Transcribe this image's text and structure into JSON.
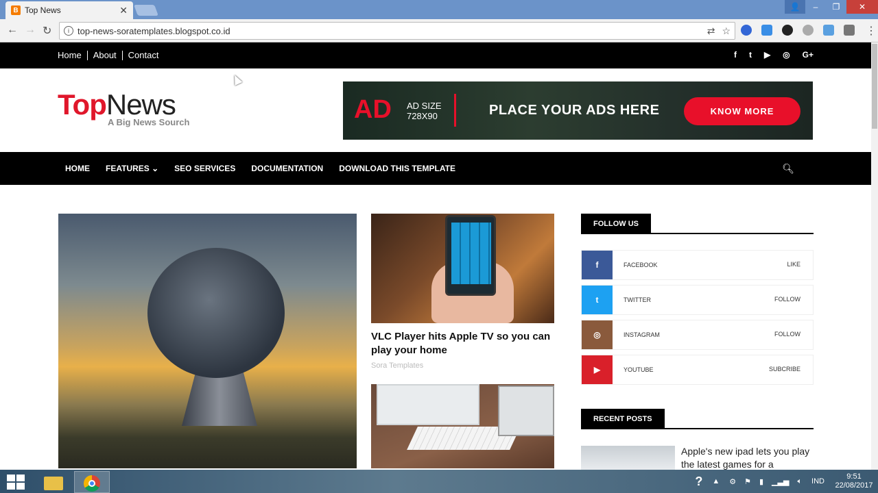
{
  "browser": {
    "tab_title": "Top News",
    "tab_close": "✕",
    "url": "top-news-soratemplates.blogspot.co.id"
  },
  "site": {
    "top_links": [
      "Home",
      "About",
      "Contact"
    ],
    "top_social": [
      "f",
      "t",
      "▶",
      "◎",
      "G+"
    ],
    "logo_top": "Top",
    "logo_news": "News",
    "tagline": "A Big News Sourch",
    "ad": {
      "big": "AD",
      "size_line1": "AD SIZE",
      "size_line2": "728X90",
      "place": "PLACE YOUR ADS HERE",
      "button": "KNOW MORE"
    },
    "nav": [
      "HOME",
      "FEATURES",
      "SEO SERVICES",
      "DOCUMENTATION",
      "DOWNLOAD THIS TEMPLATE"
    ],
    "post1": {
      "title": "VLC Player hits Apple TV so you can play your home",
      "author": "Sora Templates"
    },
    "follow_us": {
      "heading": "FOLLOW US",
      "rows": [
        {
          "icon": "f",
          "name": "FACEBOOK",
          "action": "LIKE",
          "color": "#3b5998"
        },
        {
          "icon": "t",
          "name": "TWITTER",
          "action": "FOLLOW",
          "color": "#1da1f2"
        },
        {
          "icon": "◎",
          "name": "INSTAGRAM",
          "action": "FOLLOW",
          "color": "#8a5a3c"
        },
        {
          "icon": "▶",
          "name": "YOUTUBE",
          "action": "SUBCRIBE",
          "color": "#d9202a"
        }
      ]
    },
    "recent_posts": {
      "heading": "RECENT POSTS",
      "first_title": "Apple's new ipad lets you play the latest games for a"
    }
  },
  "taskbar": {
    "lang": "IND",
    "time": "9:51",
    "date": "22/08/2017"
  }
}
